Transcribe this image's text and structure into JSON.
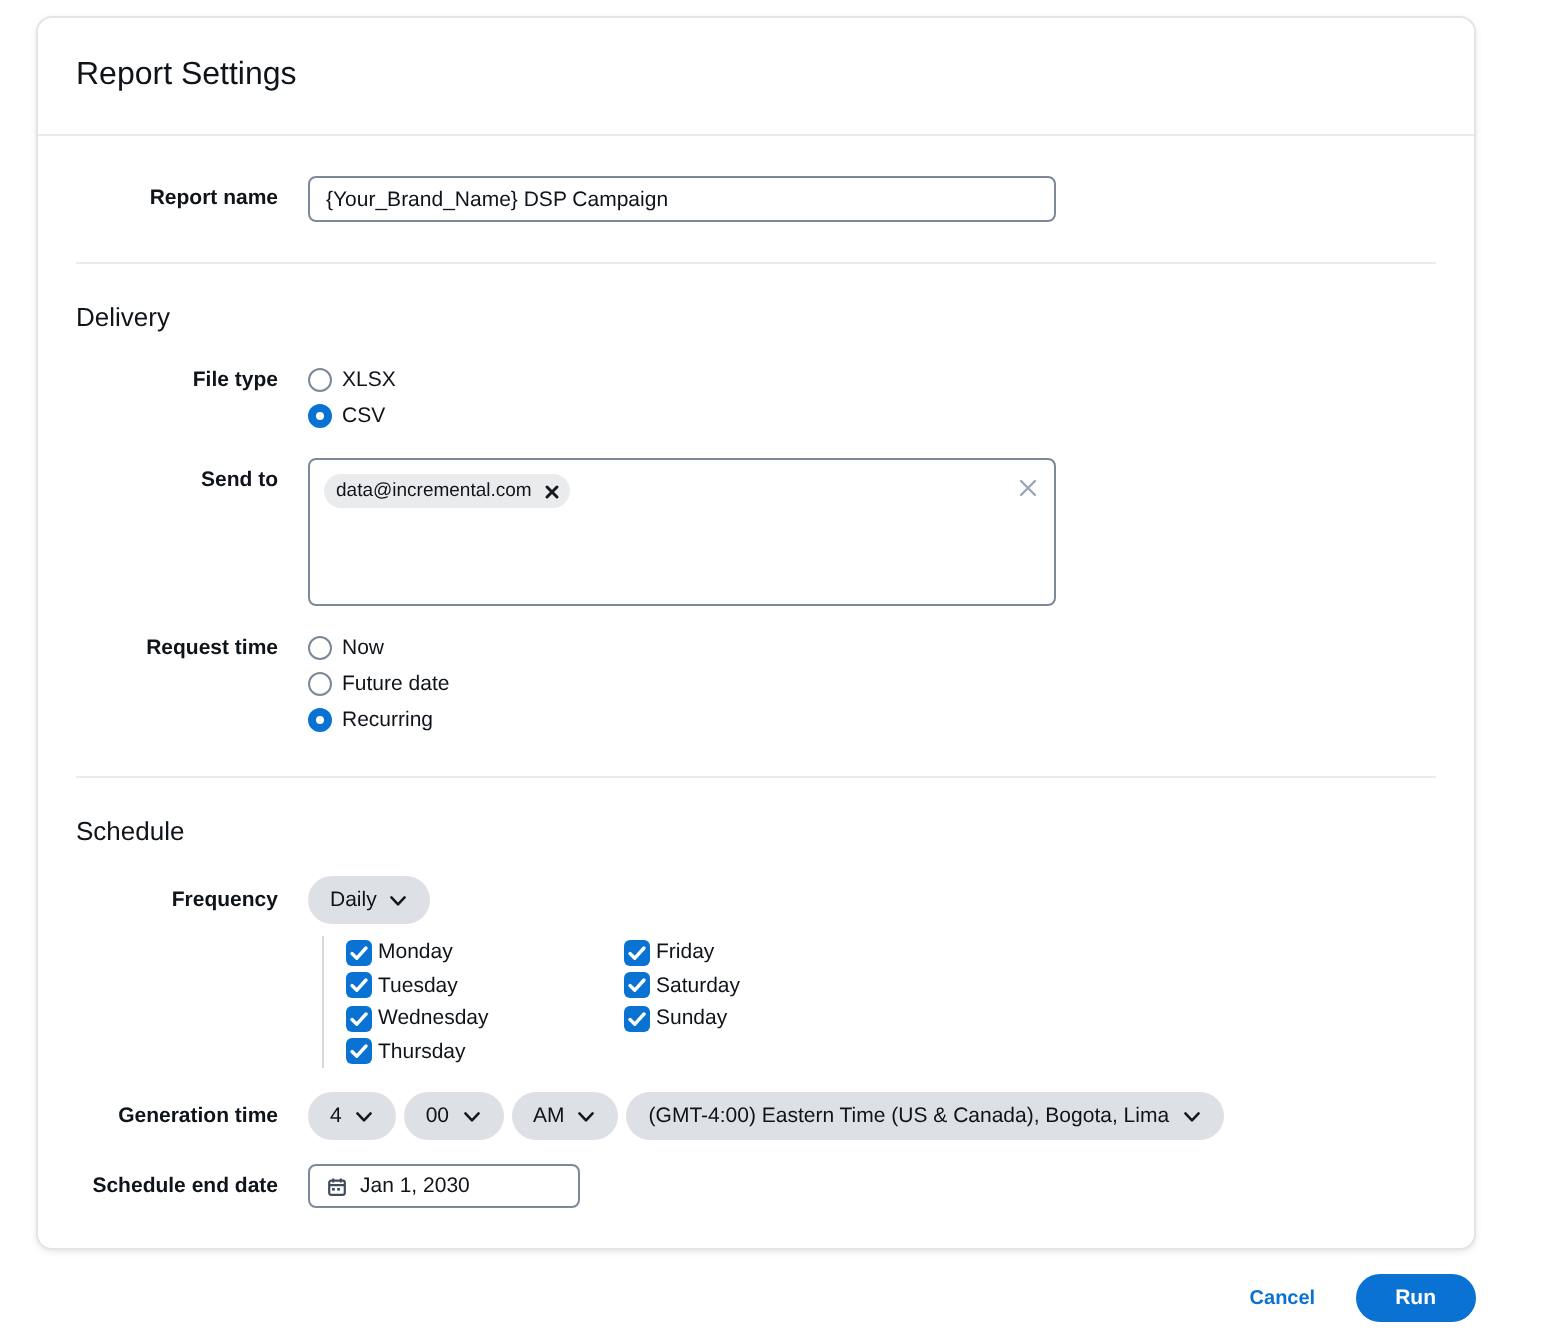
{
  "window": {
    "title": "Report Settings"
  },
  "sections": [
    {
      "fields": [
        {
          "kind": "text",
          "label": "Report name",
          "value": "{Your_Brand_Name} DSP Campaign"
        }
      ]
    },
    {
      "heading": "Delivery",
      "fields": [
        {
          "kind": "radio",
          "label": "File type",
          "options": [
            {
              "label": "XLSX",
              "selected": false
            },
            {
              "label": "CSV",
              "selected": true
            }
          ]
        },
        {
          "kind": "recipients",
          "label": "Send to",
          "tokens": [
            "data@incremental.com"
          ]
        },
        {
          "kind": "radio",
          "label": "Request time",
          "options": [
            {
              "label": "Now",
              "selected": false
            },
            {
              "label": "Future date",
              "selected": false
            },
            {
              "label": "Recurring",
              "selected": true
            }
          ]
        }
      ]
    },
    {
      "heading": "Schedule",
      "fields": [
        {
          "kind": "frequency",
          "label": "Frequency",
          "value": "Daily",
          "days": [
            {
              "label": "Monday",
              "checked": true
            },
            {
              "label": "Tuesday",
              "checked": true
            },
            {
              "label": "Wednesday",
              "checked": true
            },
            {
              "label": "Thursday",
              "checked": true
            },
            {
              "label": "Friday",
              "checked": true
            },
            {
              "label": "Saturday",
              "checked": true
            },
            {
              "label": "Sunday",
              "checked": true
            }
          ]
        },
        {
          "kind": "selects",
          "label": "Generation time",
          "values": [
            "4",
            "00",
            "AM",
            "(GMT-4:00) Eastern Time (US & Canada), Bogota, Lima"
          ]
        },
        {
          "kind": "date",
          "label": "Schedule end date",
          "value": "Jan 1, 2030"
        }
      ]
    }
  ],
  "footer": {
    "buttons": [
      {
        "kind": "link",
        "label": "Cancel"
      },
      {
        "kind": "primary",
        "label": "Run"
      }
    ]
  }
}
